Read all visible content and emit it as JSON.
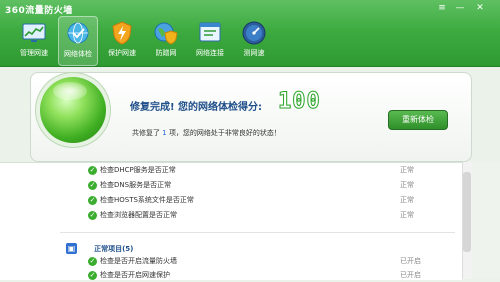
{
  "window": {
    "title": "360流量防火墙",
    "controls": [
      "≡",
      "—",
      "✕"
    ]
  },
  "nav": [
    {
      "label": "管理网速",
      "icon": "monitor-chart-icon"
    },
    {
      "label": "网络体检",
      "icon": "globe-check-icon",
      "active": true
    },
    {
      "label": "保护网速",
      "icon": "shield-lightning-icon"
    },
    {
      "label": "防蹭网",
      "icon": "globe-shield-icon"
    },
    {
      "label": "网络连接",
      "icon": "network-window-icon"
    },
    {
      "label": "测网速",
      "icon": "speedometer-icon"
    }
  ],
  "result": {
    "title": "修复完成! 您的网络体检得分:",
    "score": "100",
    "sub_pre": "共修复了",
    "sub_count": "1",
    "sub_post": "项，您的网络处于非常良好的状态！",
    "recheck_label": "重新体检"
  },
  "checks": [
    {
      "text": "检查DHCP服务是否正常",
      "status": "正常"
    },
    {
      "text": "检查DNS服务是否正常",
      "status": "正常"
    },
    {
      "text": "检查HOSTS系统文件是否正常",
      "status": "正常"
    },
    {
      "text": "检查浏览器配置是否正常",
      "status": "正常"
    }
  ],
  "section": {
    "title": "正常项目(5)"
  },
  "normal_items": [
    {
      "text": "检查是否开启流量防火墙",
      "status": "已开启"
    },
    {
      "text": "检查是否开启网速保护",
      "status": "已开启"
    }
  ],
  "colors": {
    "accent": "#3eab41",
    "title_blue": "#1f4f8a",
    "score_green": "#2fa52c"
  }
}
